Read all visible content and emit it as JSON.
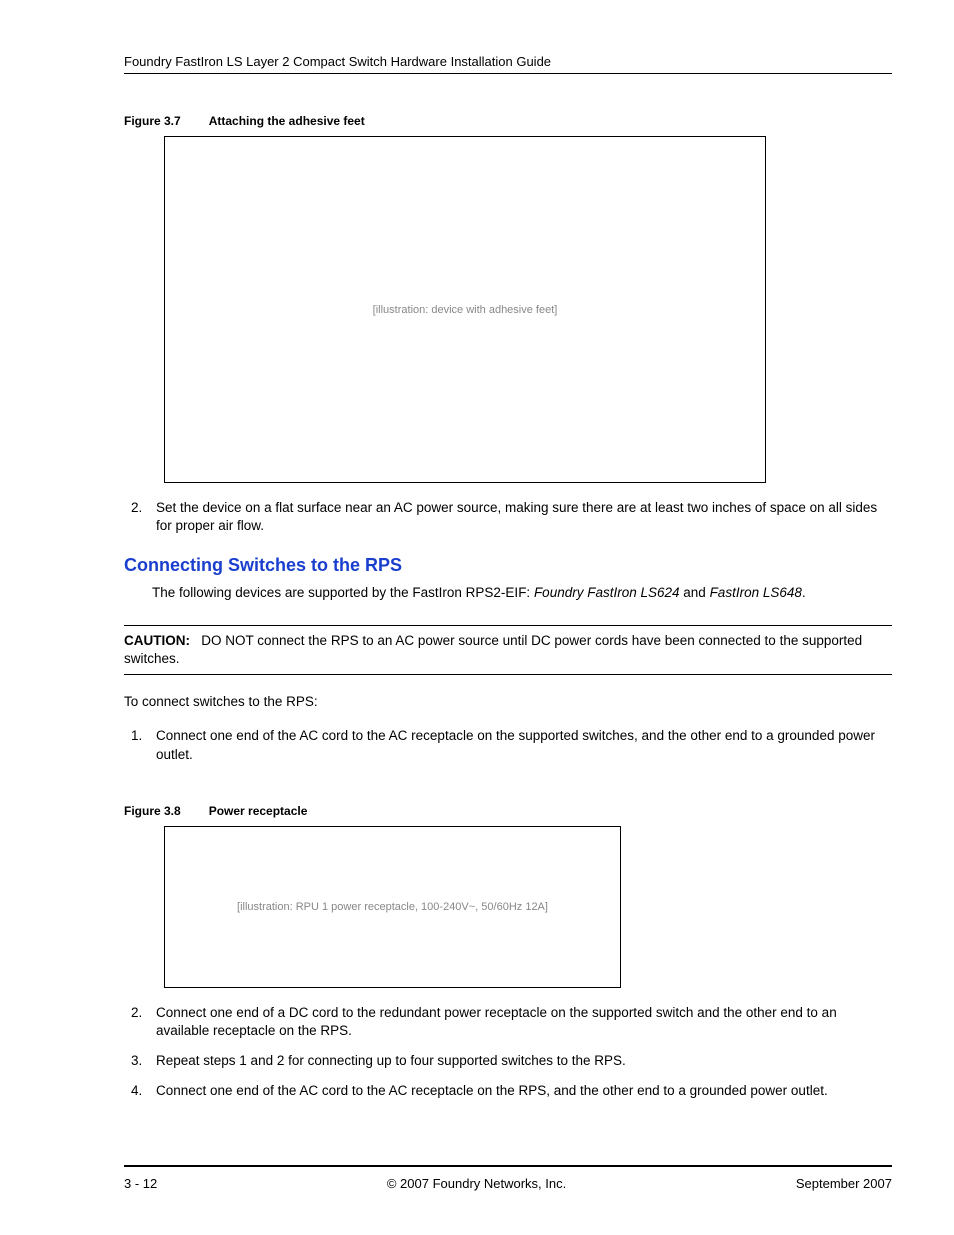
{
  "header": {
    "running": "Foundry FastIron LS Layer 2 Compact Switch Hardware Installation Guide"
  },
  "figures": {
    "f37": {
      "label": "Figure 3.7",
      "title": "Attaching the adhesive feet",
      "alt": "[illustration: device with adhesive feet]"
    },
    "f38": {
      "label": "Figure 3.8",
      "title": "Power receptacle",
      "alt": "[illustration: RPU 1 power receptacle, 100-240V~, 50/60Hz 12A]"
    }
  },
  "list1": {
    "start": 2,
    "item2": "Set the device on a flat surface near an AC power source, making sure there are at least two inches of space on all sides for proper air flow."
  },
  "section": {
    "heading": "Connecting Switches to the RPS",
    "intro_pre": "The following devices are supported by the FastIron RPS2-EIF: ",
    "intro_em1": "Foundry FastIron LS624",
    "intro_mid": " and ",
    "intro_em2": "FastIron LS648",
    "intro_post": "."
  },
  "caution": {
    "label": "CAUTION:",
    "text": "DO NOT connect the RPS to an AC power source until DC power cords have been connected to the supported switches."
  },
  "lead": "To connect switches to the RPS:",
  "list2": {
    "item1": "Connect one end of the AC cord to the AC receptacle on the supported switches, and the other end to a grounded power outlet.",
    "item2": "Connect one end of a DC cord to the redundant power receptacle on the supported switch and the other end to an available receptacle on the RPS.",
    "item3": "Repeat steps 1 and 2 for connecting up to four supported switches to the RPS.",
    "item4": "Connect one end of the AC cord to the AC receptacle on the RPS, and the other end to a grounded power outlet."
  },
  "footer": {
    "left": "3 - 12",
    "center": "© 2007 Foundry Networks, Inc.",
    "right": "September 2007"
  }
}
